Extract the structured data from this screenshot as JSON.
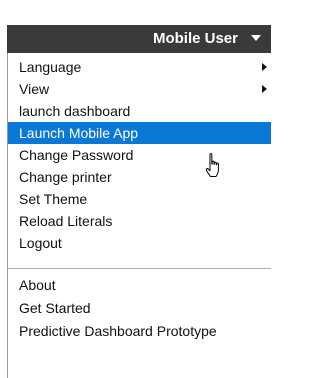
{
  "header": {
    "user_name": "Mobile User",
    "caret_icon": "caret-down-icon"
  },
  "menu": {
    "items": [
      {
        "label": "Language",
        "submenu": true
      },
      {
        "label": "View",
        "submenu": true
      },
      {
        "label": "launch dashboard",
        "submenu": false
      },
      {
        "label": "Launch Mobile App",
        "submenu": false,
        "highlighted": true
      },
      {
        "label": "Change Password",
        "submenu": false
      },
      {
        "label": "Change printer",
        "submenu": false
      },
      {
        "label": "Set Theme",
        "submenu": false
      },
      {
        "label": "Reload Literals",
        "submenu": false
      },
      {
        "label": "Logout",
        "submenu": false
      },
      {
        "label": "About",
        "submenu": false
      },
      {
        "label": "Get Started",
        "submenu": false
      },
      {
        "label": "Predictive Dashboard Prototype",
        "submenu": false
      }
    ]
  },
  "colors": {
    "header_bg": "#3a3a3a",
    "highlight_bg": "#0a78d7",
    "text": "#111111"
  },
  "cursor_icon": "hand-pointer-icon"
}
